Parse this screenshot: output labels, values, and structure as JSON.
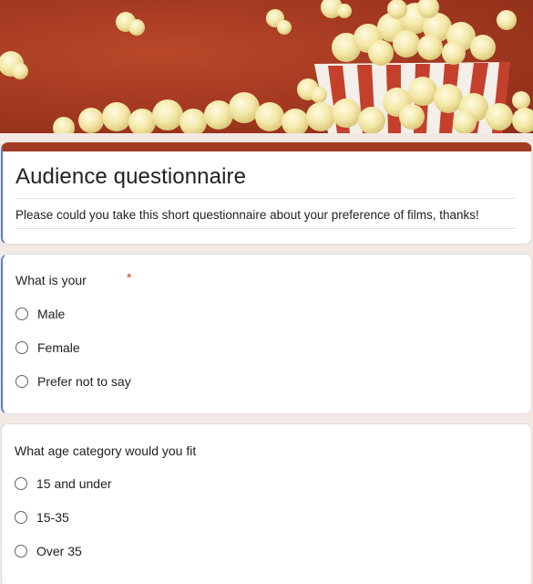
{
  "banner": {
    "theme": "popcorn",
    "background_color": "#a63a21"
  },
  "form": {
    "title": "Audience questionnaire",
    "description": "Please could you take this short questionnaire about your preference of films, thanks!",
    "accent_color": "#a23b23"
  },
  "questions": [
    {
      "text": "What is your",
      "required_mark": "*",
      "options": [
        "Male",
        "Female",
        "Prefer not to say"
      ]
    },
    {
      "text": "What age category would you fit",
      "options": [
        "15 and under",
        "15-35",
        "Over 35"
      ]
    }
  ]
}
